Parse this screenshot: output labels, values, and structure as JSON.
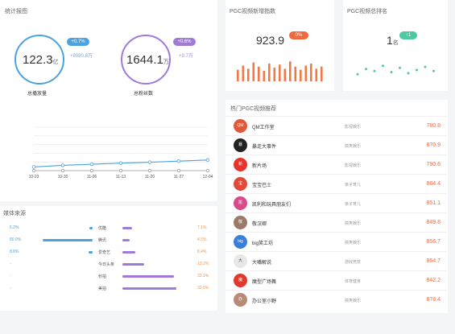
{
  "stats": {
    "title": "统计报图",
    "total_fans": {
      "value": "122.3",
      "unit": "亿",
      "change_pill": "+0.7%",
      "change_abs": "+8080.8万",
      "label": "总播放量"
    },
    "total_readers": {
      "value": "1644.1",
      "unit": "万",
      "change_pill": "+0.6%",
      "change_abs": "+9.7万",
      "label": "总粉丝数"
    },
    "colors": {
      "blue": "#4aa3e0",
      "purple": "#a07ad8"
    }
  },
  "trend_chart": {
    "x_labels": [
      "10-23",
      "10-30",
      "11-06",
      "11-13",
      "11-20",
      "11-27",
      "12-04"
    ]
  },
  "chart_data": {
    "type": "line",
    "x": [
      "10-23",
      "10-30",
      "11-06",
      "11-13",
      "11-20",
      "11-27",
      "12-04"
    ],
    "series": [
      {
        "values": [
          118.5,
          119.4,
          120.0,
          120.6,
          121.1,
          121.7,
          122.3
        ]
      },
      {
        "values": [
          0,
          0,
          0,
          0,
          0,
          0,
          0
        ]
      }
    ],
    "grid": true
  },
  "media_source": {
    "title": "媒体来源",
    "rows": [
      {
        "left_pct": "5.2%",
        "left_fill": 0.05,
        "name": "优酷",
        "right_fill": 0.16,
        "right_pct": "7.1%"
      },
      {
        "left_pct": "80.0%",
        "left_fill": 0.78,
        "name": "腾讯",
        "right_fill": 0.12,
        "right_pct": "4.5%"
      },
      {
        "left_pct": "8.8%",
        "left_fill": 0.06,
        "name": "爱奇艺",
        "right_fill": 0.2,
        "right_pct": "8.4%"
      },
      {
        "left_pct": "-",
        "left_fill": 0,
        "name": "今日头条",
        "right_fill": 0.34,
        "right_pct": "13.2%"
      },
      {
        "left_pct": "-",
        "left_fill": 0,
        "name": "秒拍",
        "right_fill": 0.82,
        "right_pct": "33.1%"
      },
      {
        "left_pct": "-",
        "left_fill": 0,
        "name": "美拍",
        "right_fill": 0.86,
        "right_pct": "33.6%"
      }
    ]
  },
  "growth": {
    "title": "PGC视频新增指数",
    "value": "923.9",
    "badge": "0%",
    "bars": [
      0.55,
      0.75,
      0.6,
      0.9,
      0.7,
      0.5,
      0.85,
      0.65,
      0.8,
      0.6,
      0.95,
      0.7,
      0.55,
      0.75,
      0.85,
      0.6,
      0.7
    ],
    "bar_color": "#f07a47"
  },
  "ranking_card": {
    "title": "PGC视频总排名",
    "value": "1",
    "unit": "名",
    "badge": "↑1",
    "dots": [
      0.3,
      0.55,
      0.45,
      0.7,
      0.4,
      0.6,
      0.35,
      0.5,
      0.65,
      0.45
    ],
    "dot_color": "#4fc9a4"
  },
  "hot": {
    "title": "热门PGC视频推荐",
    "items": [
      {
        "name": "QM工作室",
        "category": "影视娱乐",
        "score": "780.8",
        "color": "#e05a3a",
        "avatar": "QM"
      },
      {
        "name": "暴走大事件",
        "category": "搞笑娱乐",
        "score": "870.9",
        "color": "#222222",
        "avatar": "暴"
      },
      {
        "name": "新片场",
        "category": "影视娱乐",
        "score": "790.6",
        "color": "#e8332c",
        "avatar": "新"
      },
      {
        "name": "宝宝巴士",
        "category": "亲子育儿",
        "score": "884.4",
        "color": "#e0483a",
        "avatar": "宝"
      },
      {
        "name": "凯利和玩具朋友们",
        "category": "亲子育儿",
        "score": "851.1",
        "color": "#d84a8a",
        "avatar": "凯"
      },
      {
        "name": "敬汉卿",
        "category": "搞笑娱乐",
        "score": "849.8",
        "color": "#9a7b6a",
        "avatar": "敬"
      },
      {
        "name": "big笑工坊",
        "category": "搞笑娱乐",
        "score": "856.7",
        "color": "#3a7fd8",
        "avatar": "big"
      },
      {
        "name": "大嘴解说",
        "category": "游戏竞技",
        "score": "864.7",
        "color": "#e8e8e8",
        "avatar": "大"
      },
      {
        "name": "魔型广场舞",
        "category": "体育健身",
        "score": "842.2",
        "color": "#e03a2c",
        "avatar": "魔"
      },
      {
        "name": "办公室小野",
        "category": "搞笑娱乐",
        "score": "878.4",
        "color": "#b88a78",
        "avatar": "办"
      }
    ]
  }
}
